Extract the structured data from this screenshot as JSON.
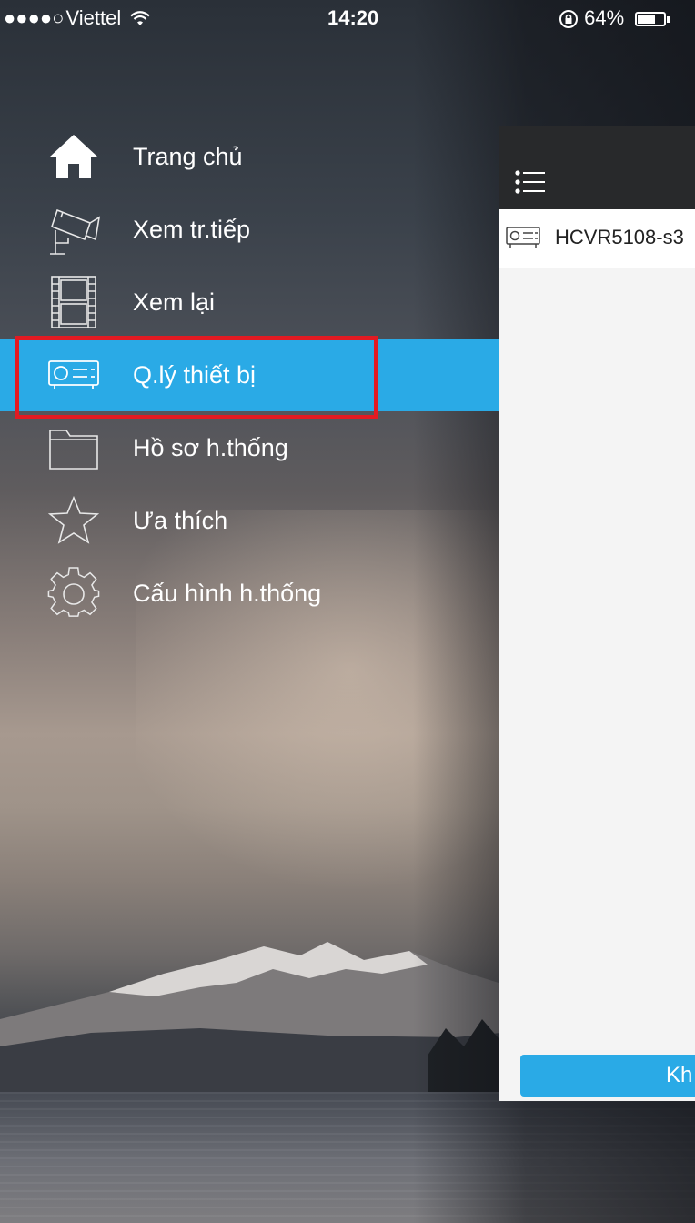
{
  "status_bar": {
    "signal": "●●●●○",
    "carrier": "Viettel",
    "time": "14:20",
    "battery_percent": "64%",
    "battery_level": 0.64
  },
  "menu": {
    "items": [
      {
        "label": "Trang chủ",
        "icon": "home-icon"
      },
      {
        "label": "Xem tr.tiếp",
        "icon": "camera-icon"
      },
      {
        "label": "Xem lại",
        "icon": "film-icon"
      },
      {
        "label": "Q.lý thiết bị",
        "icon": "device-icon",
        "active": true
      },
      {
        "label": "Hồ sơ h.thống",
        "icon": "folder-icon"
      },
      {
        "label": "Ưa thích",
        "icon": "star-icon"
      },
      {
        "label": "Cấu hình h.thống",
        "icon": "gear-icon"
      }
    ]
  },
  "panel": {
    "device_name": "HCVR5108-s3",
    "footer_button": "Kh"
  },
  "colors": {
    "accent": "#2aaae6",
    "highlight": "#e21a22",
    "panel_header": "#28292b"
  }
}
